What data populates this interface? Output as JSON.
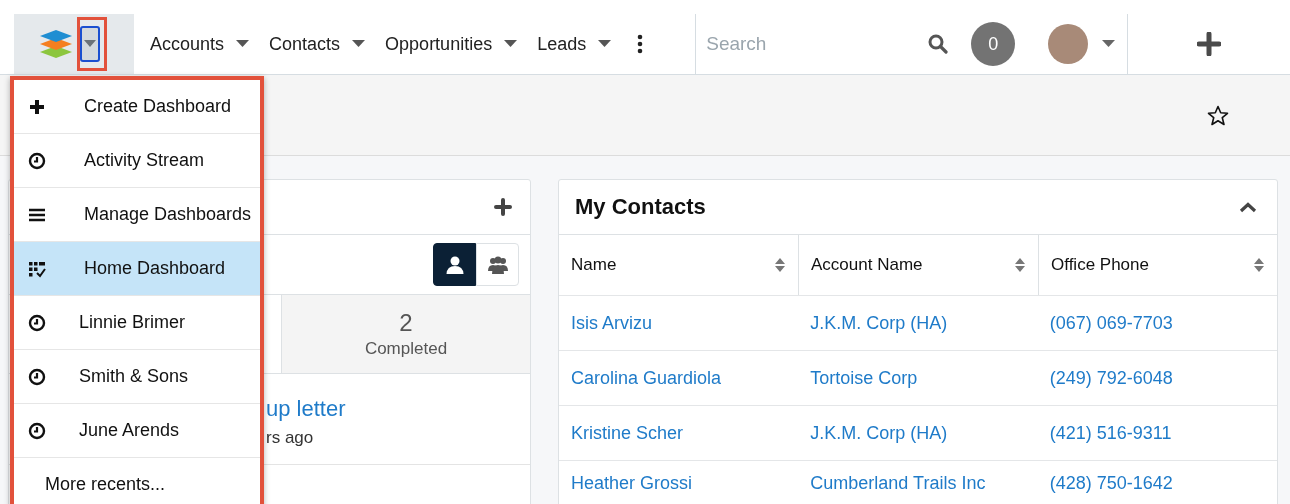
{
  "navbar": {
    "modules": [
      {
        "label": "Accounts"
      },
      {
        "label": "Contacts"
      },
      {
        "label": "Opportunities"
      },
      {
        "label": "Leads"
      }
    ],
    "search": {
      "placeholder": "Search"
    },
    "notifications": {
      "count": "0"
    }
  },
  "dashboard_menu": {
    "items": [
      {
        "kind": "create",
        "label": "Create Dashboard",
        "selected": false
      },
      {
        "kind": "stream",
        "label": "Activity Stream",
        "selected": false
      },
      {
        "kind": "manage",
        "label": "Manage Dashboards",
        "selected": false
      },
      {
        "kind": "dashboard",
        "label": "Home Dashboard",
        "selected": true
      },
      {
        "kind": "recent",
        "label": "Linnie Brimer",
        "selected": false
      },
      {
        "kind": "recent",
        "label": "Smith & Sons",
        "selected": false
      },
      {
        "kind": "recent",
        "label": "June Arends",
        "selected": false
      },
      {
        "kind": "more",
        "label": "More recents...",
        "selected": false
      }
    ]
  },
  "left_dashlet": {
    "visibility": [
      {
        "kind": "user",
        "selected": true
      },
      {
        "kind": "team",
        "selected": false
      }
    ],
    "tabs": [
      {
        "count": "2",
        "label": "Completed"
      }
    ],
    "items": [
      {
        "title": "up letter",
        "meta": "rs ago"
      }
    ]
  },
  "contacts_dashlet": {
    "title": "My Contacts",
    "columns": [
      "Name",
      "Account Name",
      "Office Phone"
    ],
    "rows": [
      [
        "Isis Arvizu",
        "J.K.M. Corp (HA)",
        "(067) 069-7703"
      ],
      [
        "Carolina Guardiola",
        "Tortoise Corp",
        "(249) 792-6048"
      ],
      [
        "Kristine Scher",
        "J.K.M. Corp (HA)",
        "(421) 516-9311"
      ],
      [
        "Heather Grossi",
        "Cumberland Trails Inc",
        "(428) 750-1642"
      ]
    ]
  }
}
